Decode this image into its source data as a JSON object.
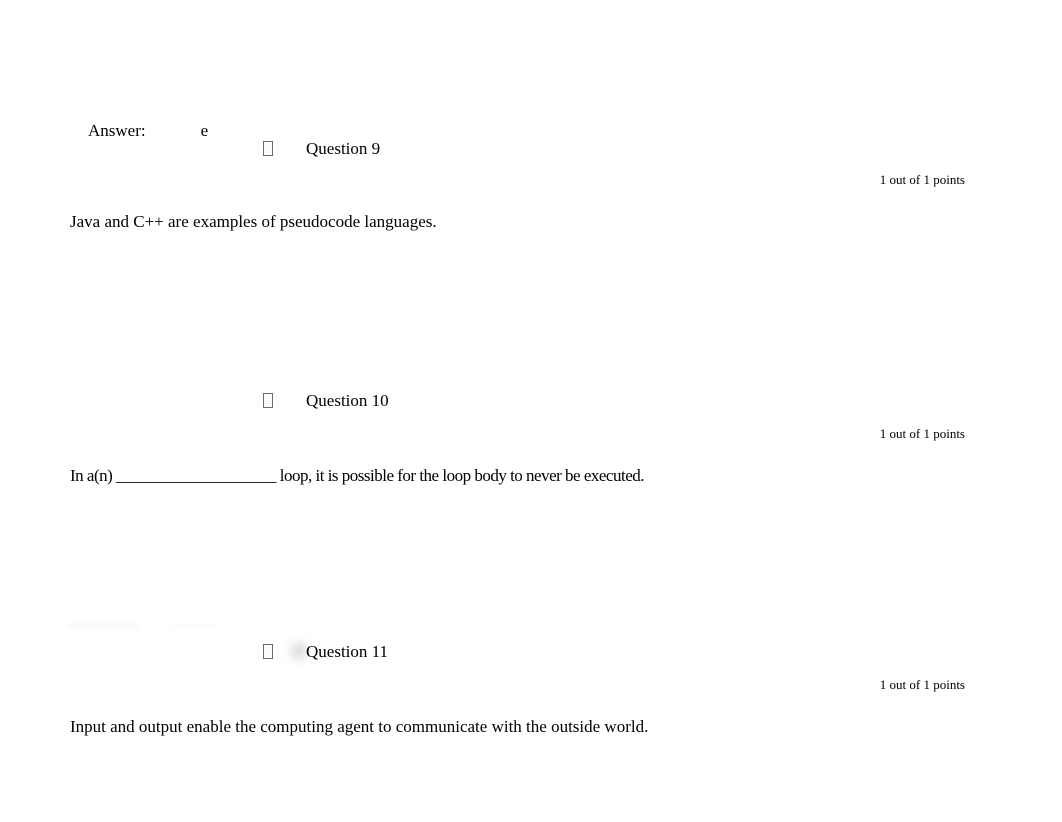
{
  "document": {
    "type": "quiz-results",
    "background_color": "#ffffff",
    "text_color": "#000000"
  },
  "answer_block": {
    "label": "Answer:",
    "value": "e"
  },
  "questions": [
    {
      "marker_icon": "missing-glyph-box-icon",
      "title": "Question 9",
      "points": "1 out of 1 points",
      "body": "Java and C++ are examples of pseudocode languages."
    },
    {
      "marker_icon": "missing-glyph-box-icon",
      "title": "Question 10",
      "points": "1 out of 1 points",
      "body": "In a(n) ____________________ loop, it is possible for the loop body to never be executed."
    },
    {
      "marker_icon": "missing-glyph-box-icon",
      "title": "Question 11",
      "points": "1 out of 1 points",
      "body": "Input and output enable the computing agent to communicate with the outside world."
    }
  ]
}
